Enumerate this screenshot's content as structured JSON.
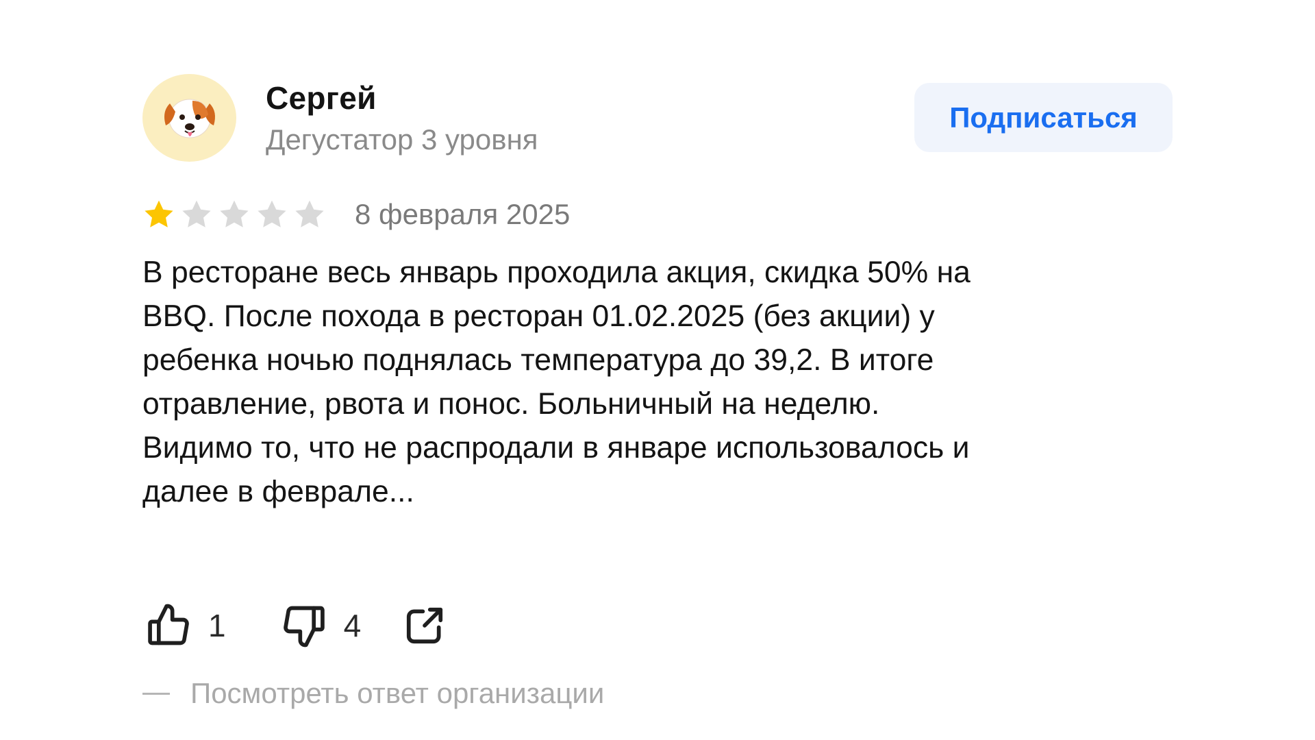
{
  "author": {
    "name": "Сергей",
    "level": "Дегустатор 3 уровня",
    "avatar_icon": "dog-emoji-icon"
  },
  "subscribe": {
    "label": "Подписаться"
  },
  "review": {
    "rating": 1,
    "rating_max": 5,
    "date": "8 февраля 2025",
    "text_lines": [
      "В ресторане весь январь проходила акция, скидка 50% на",
      "BBQ. После похода в ресторан 01.02.2025 (без акции) у",
      "ребенка ночью поднялась температура до 39,2. В итоге",
      "отравление, рвота и понос. Больничный на неделю.",
      "Видимо то, что не распродали в январе использовалось и",
      "далее в феврале..."
    ]
  },
  "reactions": {
    "likes": "1",
    "dislikes": "4",
    "like_icon": "thumbs-up-icon",
    "dislike_icon": "thumbs-down-icon",
    "share_icon": "share-icon"
  },
  "org_reply": {
    "label": "Посмотреть ответ организации"
  },
  "colors": {
    "star_filled": "#fcc502",
    "star_empty": "#d9d9d9",
    "accent": "#1a6ef0",
    "button_bg": "#f0f4fc",
    "avatar_bg": "#fbeec0"
  }
}
